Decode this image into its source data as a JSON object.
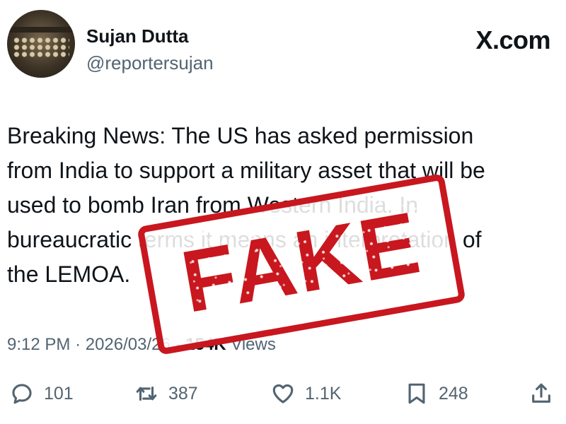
{
  "author": {
    "name": "Sujan Dutta",
    "handle": "@reportersujan"
  },
  "brand": "X.com",
  "tweet_text": "Breaking News: The US has asked permission\nfrom India to support a military asset that will be\nused to bomb Iran from Western India. In\nbureaucratic terms it means an interpretation of\nthe LEMOA.",
  "meta": {
    "time": "9:12 PM",
    "date": "2026/03/26",
    "views_count": "154K",
    "views_label": "Views",
    "separator": "·"
  },
  "actions": {
    "replies": "101",
    "reposts": "387",
    "likes": "1.1K",
    "bookmarks": "248"
  },
  "stamp": {
    "text": "FAKE",
    "color": "#c8171e"
  },
  "colors": {
    "text": "#0f1419",
    "secondary": "#536471"
  }
}
